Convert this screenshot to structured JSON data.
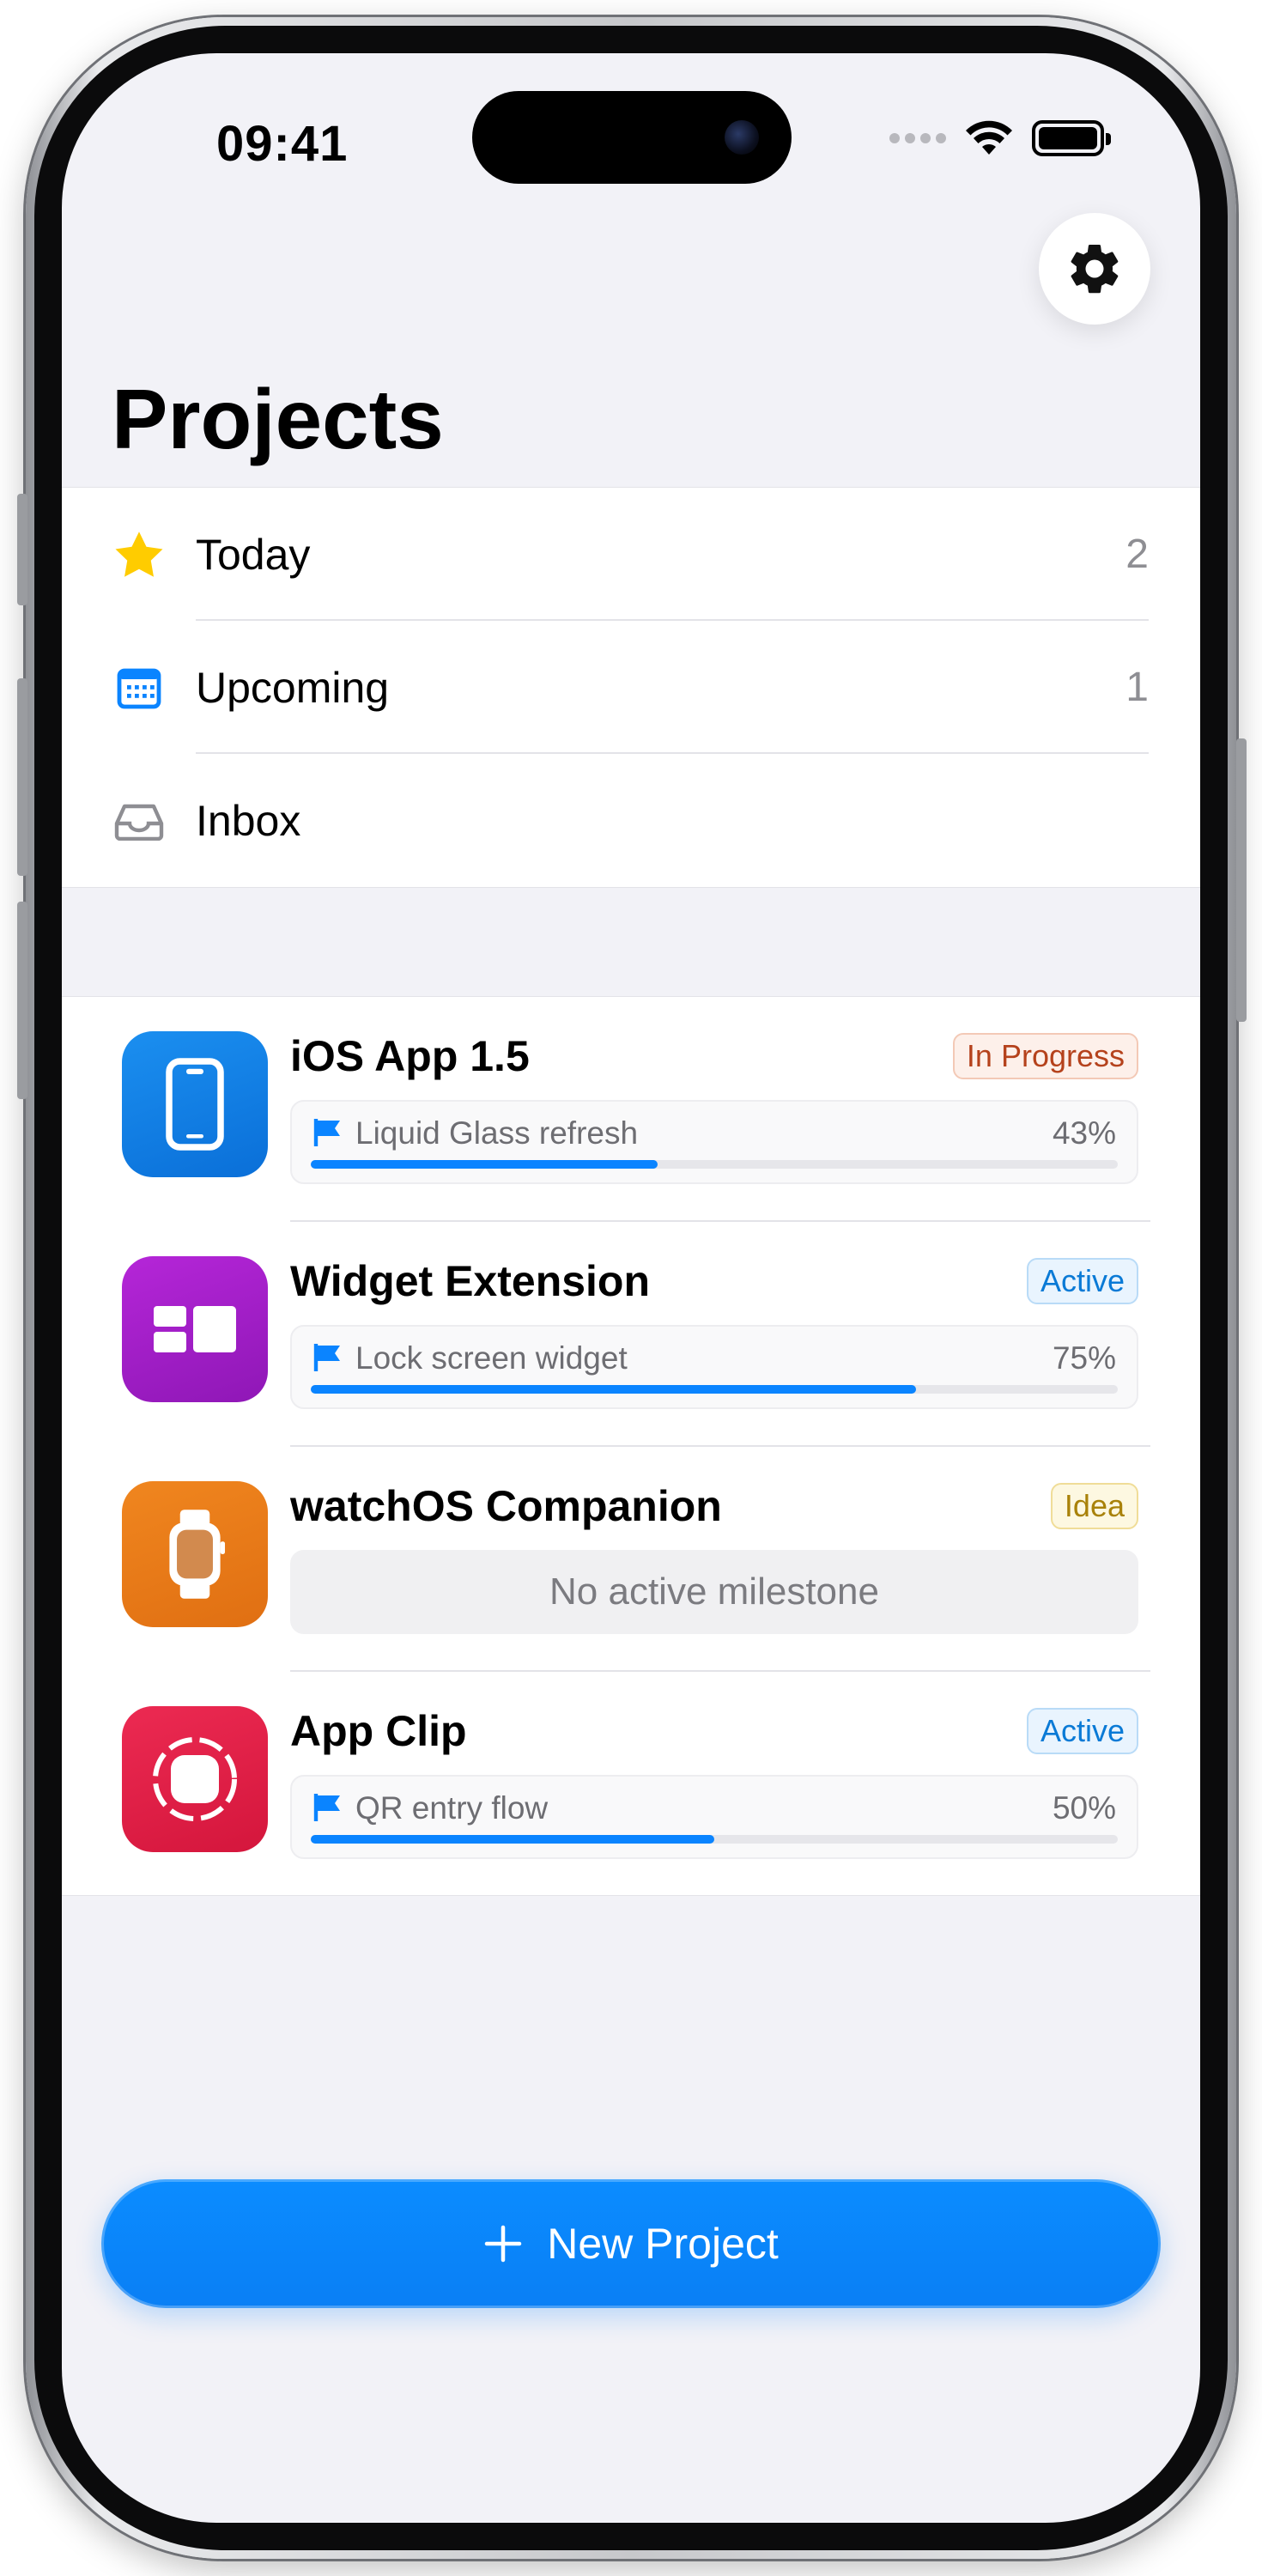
{
  "status_bar": {
    "time": "09:41"
  },
  "header": {
    "title": "Projects",
    "settings_icon": "gear-icon"
  },
  "smart_lists": [
    {
      "label": "Today",
      "count": "2",
      "icon": "star-icon",
      "icon_color": "#ffcc00"
    },
    {
      "label": "Upcoming",
      "count": "1",
      "icon": "calendar-icon",
      "icon_color": "#0a84ff"
    },
    {
      "label": "Inbox",
      "count": "",
      "icon": "tray-icon",
      "icon_color": "#8e8e93"
    }
  ],
  "projects": [
    {
      "title": "iOS App 1.5",
      "status": "In Progress",
      "icon": "iphone-icon",
      "icon_color": "#0a7ae8",
      "milestone": {
        "label": "Liquid Glass refresh",
        "percent_text": "43%",
        "progress": 0.43
      }
    },
    {
      "title": "Widget Extension",
      "status": "Active",
      "icon": "widget-icon",
      "icon_color": "#a21fc9",
      "milestone": {
        "label": "Lock screen widget",
        "percent_text": "75%",
        "progress": 0.75
      }
    },
    {
      "title": "watchOS Companion",
      "status": "Idea",
      "icon": "watch-icon",
      "icon_color": "#ea7a1c",
      "milestone": {
        "empty_text": "No active milestone"
      }
    },
    {
      "title": "App Clip",
      "status": "Active",
      "icon": "app-clip-icon",
      "icon_color": "#e31b45",
      "milestone": {
        "label": "QR entry flow",
        "percent_text": "50%",
        "progress": 0.5
      }
    }
  ],
  "new_project_button": {
    "label": "New Project",
    "icon": "plus-icon"
  },
  "colors": {
    "accent": "#0a84ff",
    "background": "#f2f2f7"
  }
}
